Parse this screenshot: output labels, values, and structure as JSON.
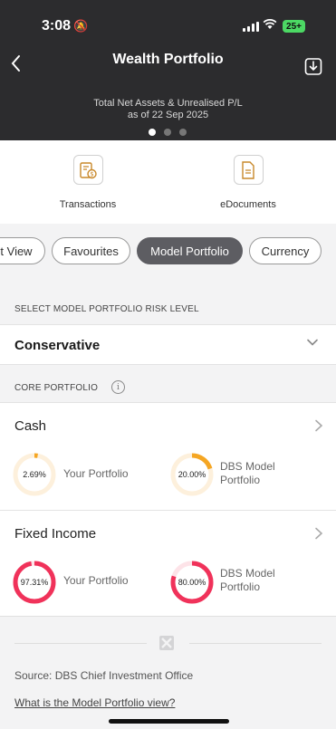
{
  "status_bar": {
    "time": "3:08",
    "battery": "25+"
  },
  "header": {
    "title": "Wealth Portfolio",
    "subtitle_line1": "Total Net Assets & Unrealised P/L",
    "subtitle_line2": "as of 22 Sep 2025",
    "carousel_dots": 3,
    "active_dot": 0
  },
  "quick_actions": [
    {
      "label": "Transactions",
      "icon": "receipt-dollar-icon"
    },
    {
      "label": "eDocuments",
      "icon": "document-icon"
    }
  ],
  "tabs": [
    {
      "label": "t View",
      "active": false
    },
    {
      "label": "Favourites",
      "active": false
    },
    {
      "label": "Model Portfolio",
      "active": true
    },
    {
      "label": "Currency",
      "active": false
    }
  ],
  "risk": {
    "section_label": "SELECT MODEL PORTFOLIO RISK LEVEL",
    "selected": "Conservative"
  },
  "core": {
    "section_label": "CORE PORTFOLIO"
  },
  "portfolio_items": [
    {
      "name": "Cash",
      "your": {
        "value": "2.69%",
        "fraction": 0.0269,
        "caption": "Your Portfolio"
      },
      "model": {
        "value": "20.00%",
        "fraction": 0.2,
        "caption_line1": "DBS Model",
        "caption_line2": "Portfolio"
      },
      "color": "#f5a623",
      "track_color": "#fdf0dc"
    },
    {
      "name": "Fixed Income",
      "your": {
        "value": "97.31%",
        "fraction": 0.9731,
        "caption": "Your Portfolio"
      },
      "model": {
        "value": "80.00%",
        "fraction": 0.8,
        "caption_line1": "DBS Model",
        "caption_line2": "Portfolio"
      },
      "color": "#f0325a",
      "track_color": "#fde3e8"
    }
  ],
  "footer": {
    "source": "Source: DBS Chief Investment Office",
    "link": "What is the Model Portfolio view?"
  }
}
